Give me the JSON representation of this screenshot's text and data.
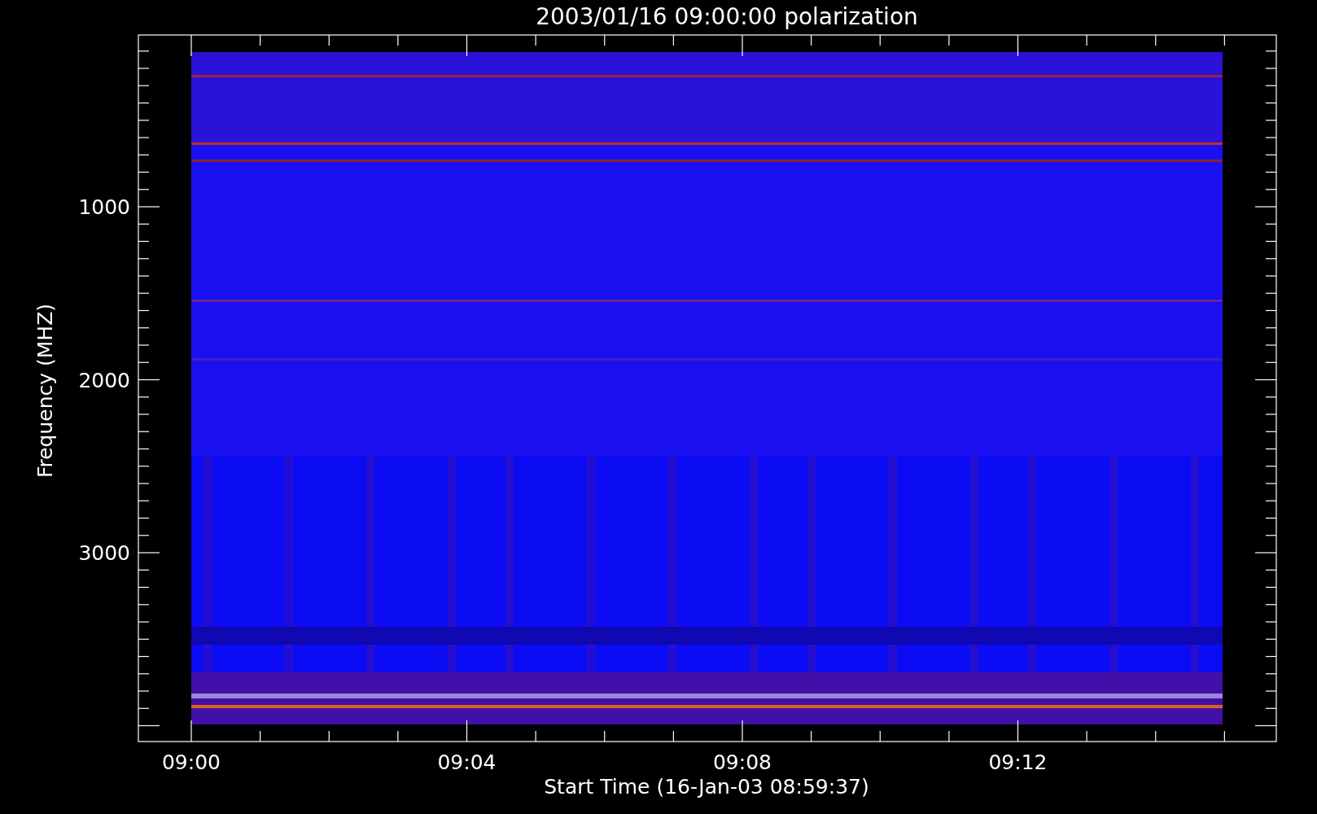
{
  "plot": {
    "title": "2003/01/16 09:00:00 polarization",
    "ylabel": "Frequency (MHZ)",
    "xlabel": "Start Time (16-Jan-03 08:59:37)",
    "xticks": [
      "09:00",
      "09:04",
      "09:08",
      "09:12"
    ],
    "yticks": [
      "1000",
      "2000",
      "3000"
    ]
  }
}
